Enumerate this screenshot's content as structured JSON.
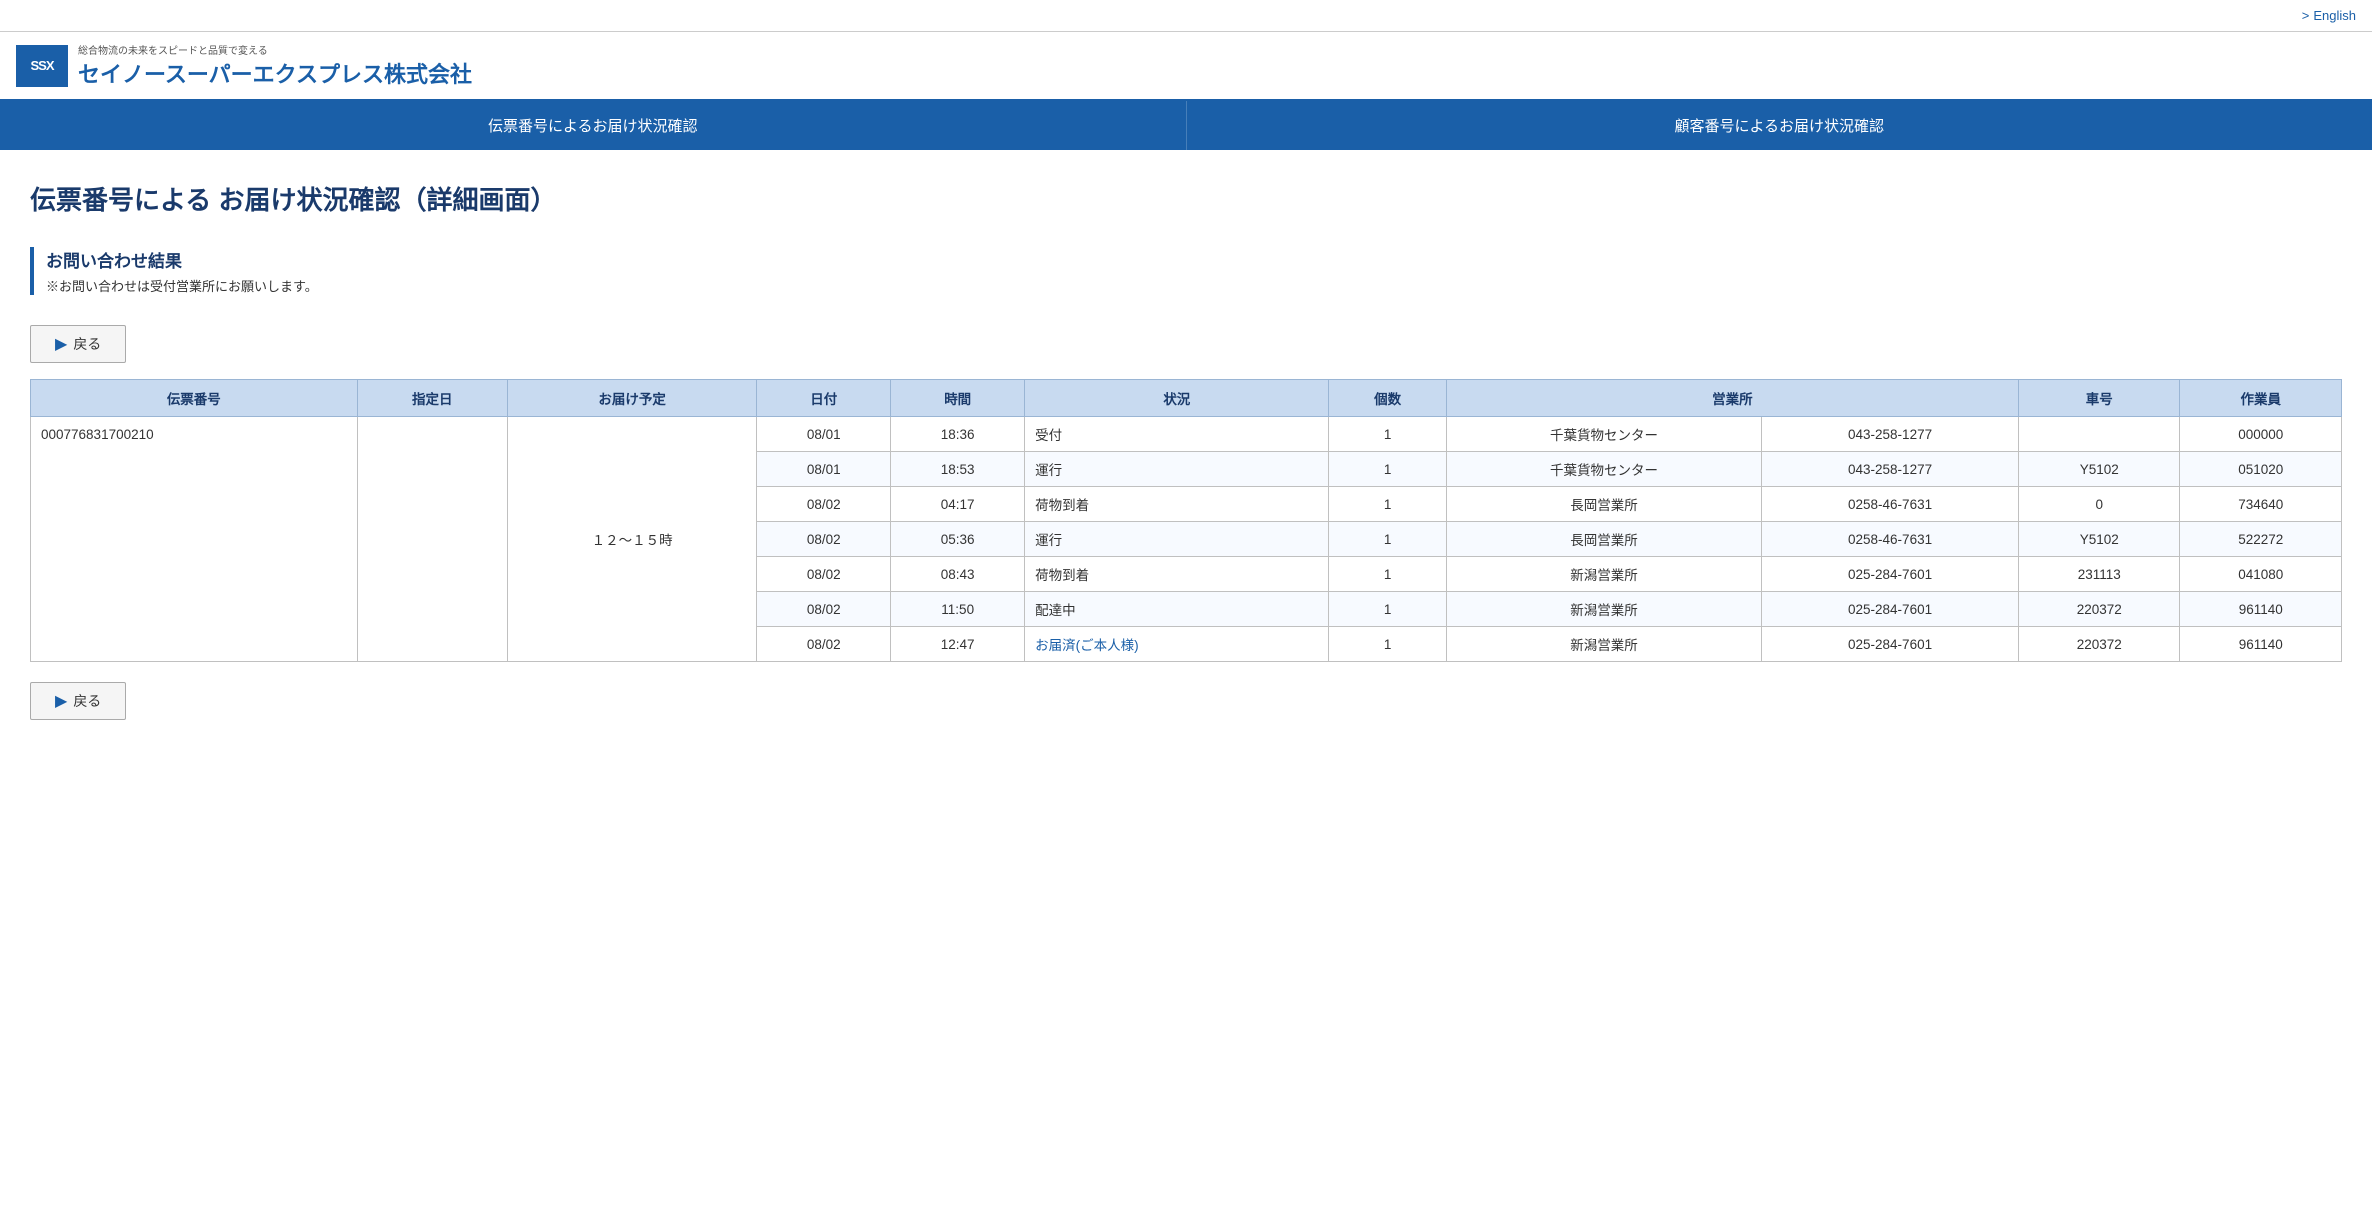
{
  "topbar": {
    "lang_label": "English"
  },
  "header": {
    "logo_abbr": "SSX",
    "logo_sub": "総合物流の未来をスピードと品質で変える",
    "logo_main": "セイノースーパーエクスプレス株式会社"
  },
  "nav": {
    "items": [
      {
        "id": "nav-denpyo",
        "label": "伝票番号によるお届け状況確認"
      },
      {
        "id": "nav-kokyaku",
        "label": "顧客番号によるお届け状況確認"
      }
    ]
  },
  "page": {
    "title": "伝票番号による お届け状況確認（詳細画面）",
    "info_heading": "お問い合わせ結果",
    "info_note": "※お問い合わせは受付営業所にお願いします。",
    "back_button": "戻る"
  },
  "table": {
    "columns": [
      "伝票番号",
      "指定日",
      "お届け予定",
      "日付",
      "時間",
      "状況",
      "個数",
      "営業所",
      "",
      "車号",
      "作業員"
    ],
    "columns_display": [
      "伝票番号",
      "指定日",
      "お届け予定",
      "日付",
      "時間",
      "状況",
      "個数",
      "営業所",
      "車号",
      "作業員"
    ],
    "tracking_number": "000776831700210",
    "delivery_estimate": "１２～１５時",
    "rows": [
      {
        "date": "08/01",
        "time": "18:36",
        "status": "受付",
        "status_link": false,
        "count": "1",
        "office_name": "千葉貨物センター",
        "office_tel": "043-258-1277",
        "car": "",
        "worker": "000000"
      },
      {
        "date": "08/01",
        "time": "18:53",
        "status": "運行",
        "status_link": false,
        "count": "1",
        "office_name": "千葉貨物センター",
        "office_tel": "043-258-1277",
        "car": "Y5102",
        "worker": "051020"
      },
      {
        "date": "08/02",
        "time": "04:17",
        "status": "荷物到着",
        "status_link": false,
        "count": "1",
        "office_name": "長岡営業所",
        "office_tel": "0258-46-7631",
        "car": "0",
        "worker": "734640"
      },
      {
        "date": "08/02",
        "time": "05:36",
        "status": "運行",
        "status_link": false,
        "count": "1",
        "office_name": "長岡営業所",
        "office_tel": "0258-46-7631",
        "car": "Y5102",
        "worker": "522272"
      },
      {
        "date": "08/02",
        "time": "08:43",
        "status": "荷物到着",
        "status_link": false,
        "count": "1",
        "office_name": "新潟営業所",
        "office_tel": "025-284-7601",
        "car": "231113",
        "worker": "041080"
      },
      {
        "date": "08/02",
        "time": "11:50",
        "status": "配達中",
        "status_link": false,
        "count": "1",
        "office_name": "新潟営業所",
        "office_tel": "025-284-7601",
        "car": "220372",
        "worker": "961140"
      },
      {
        "date": "08/02",
        "time": "12:47",
        "status": "お届済(ご本人様)",
        "status_link": true,
        "count": "1",
        "office_name": "新潟営業所",
        "office_tel": "025-284-7601",
        "car": "220372",
        "worker": "961140"
      }
    ]
  }
}
